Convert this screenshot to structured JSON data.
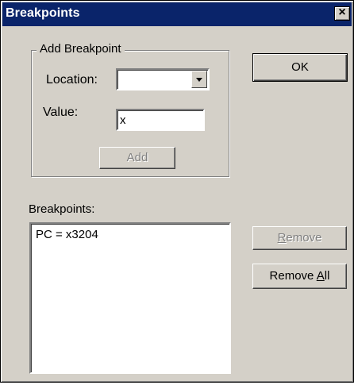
{
  "window": {
    "title": "Breakpoints",
    "close_glyph": "×"
  },
  "add_group": {
    "label": "Add Breakpoint",
    "location_label": "Location:",
    "location_value": "",
    "value_label": "Value:",
    "value_input": "x",
    "add_button": "Add"
  },
  "buttons": {
    "ok": "OK",
    "remove_prefix": "",
    "remove_mnemonic": "R",
    "remove_suffix": "emove",
    "remove_all_prefix": "Remove ",
    "remove_all_mnemonic": "A",
    "remove_all_suffix": "ll"
  },
  "list": {
    "label": "Breakpoints:",
    "items": [
      "PC = x3204"
    ]
  },
  "colors": {
    "titlebar": "#0a246a",
    "face": "#d4d0c8"
  }
}
